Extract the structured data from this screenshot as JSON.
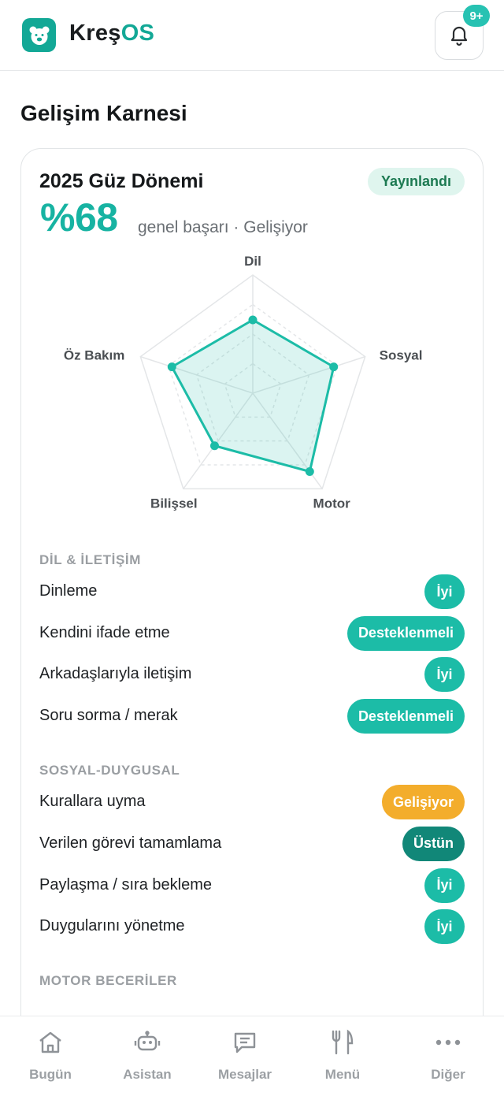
{
  "app": {
    "brand_prefix": "Kreş",
    "brand_suffix": "OS",
    "notification_badge": "9+",
    "accent_color": "#13a896"
  },
  "page": {
    "title": "Gelişim Karnesi"
  },
  "report": {
    "term": "2025 Güz Dönemi",
    "status": "Yayınlandı",
    "score": "%68",
    "score_caption": "genel başarı · Gelişiyor"
  },
  "chart_data": {
    "type": "radar",
    "axes": [
      "Dil",
      "Sosyal",
      "Motor",
      "Bilişsel",
      "Öz Bakım"
    ],
    "values": [
      0.62,
      0.72,
      0.82,
      0.55,
      0.72
    ],
    "range": [
      0,
      1
    ],
    "fill_color": "#1cbca7"
  },
  "sections": [
    {
      "title": "DİL & İLETİŞİM",
      "items": [
        {
          "label": "Dinleme",
          "rating": "İyi",
          "kind": "iyi"
        },
        {
          "label": "Kendini ifade etme",
          "rating": "Desteklenmeli",
          "kind": "destek"
        },
        {
          "label": "Arkadaşlarıyla iletişim",
          "rating": "İyi",
          "kind": "iyi"
        },
        {
          "label": "Soru sorma / merak",
          "rating": "Desteklenmeli",
          "kind": "destek"
        }
      ]
    },
    {
      "title": "SOSYAL-DUYGUSAL",
      "items": [
        {
          "label": "Kurallara uyma",
          "rating": "Gelişiyor",
          "kind": "gelisiyor"
        },
        {
          "label": "Verilen görevi tamamlama",
          "rating": "Üstün",
          "kind": "ustun"
        },
        {
          "label": "Paylaşma / sıra bekleme",
          "rating": "İyi",
          "kind": "iyi"
        },
        {
          "label": "Duygularını yönetme",
          "rating": "İyi",
          "kind": "iyi"
        }
      ]
    },
    {
      "title": "MOTOR BECERİLER",
      "items": []
    }
  ],
  "nav": [
    {
      "label": "Bugün",
      "icon": "home-icon"
    },
    {
      "label": "Asistan",
      "icon": "robot-icon"
    },
    {
      "label": "Mesajlar",
      "icon": "message-icon"
    },
    {
      "label": "Menü",
      "icon": "fork-knife-icon"
    },
    {
      "label": "Diğer",
      "icon": "more-icon"
    }
  ]
}
